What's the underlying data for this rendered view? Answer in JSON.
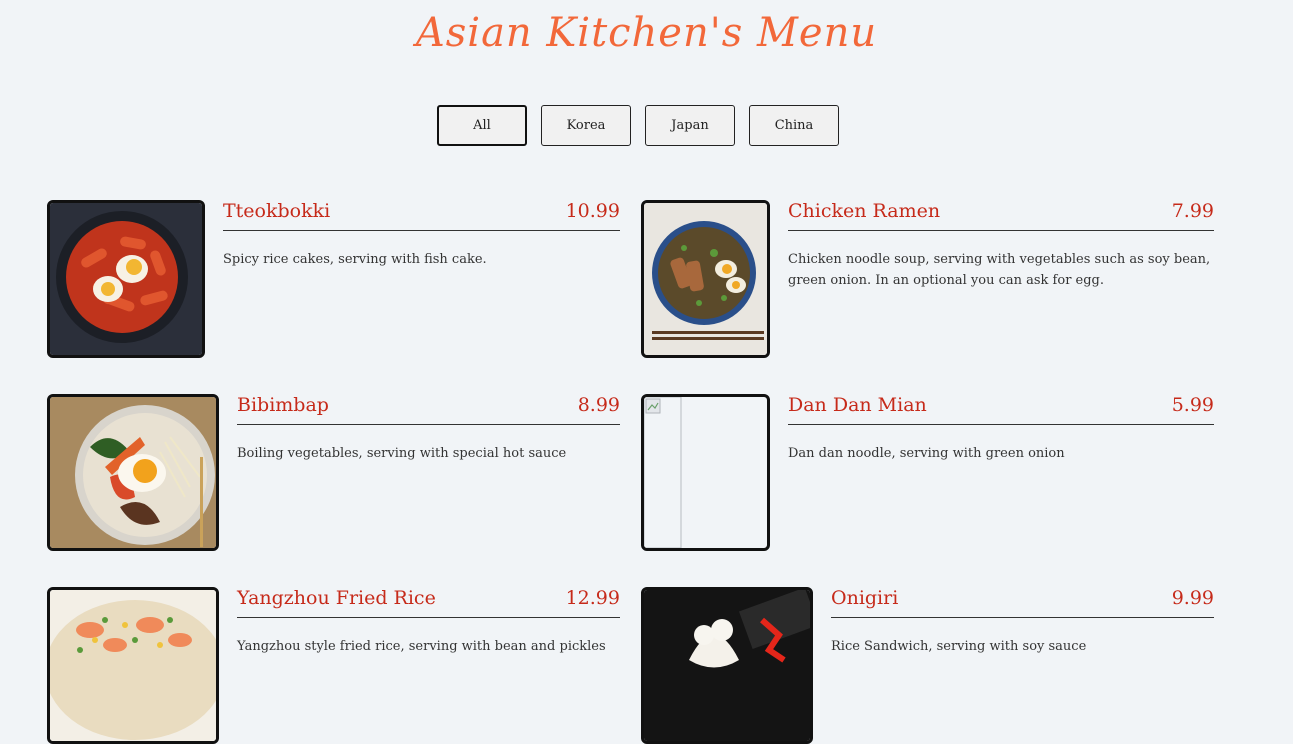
{
  "title": "Asian Kitchen's Menu",
  "filters": [
    {
      "label": "All",
      "active": true
    },
    {
      "label": "Korea",
      "active": false
    },
    {
      "label": "Japan",
      "active": false
    },
    {
      "label": "China",
      "active": false
    }
  ],
  "items": [
    {
      "name": "Tteokbokki",
      "price": "10.99",
      "desc": "Spicy rice cakes, serving with fish cake."
    },
    {
      "name": "Chicken Ramen",
      "price": "7.99",
      "desc": "Chicken noodle soup, serving with vegetables such as soy bean, green onion. In an optional you can ask for egg."
    },
    {
      "name": "Bibimbap",
      "price": "8.99",
      "desc": "Boiling vegetables, serving with special hot sauce"
    },
    {
      "name": "Dan Dan Mian",
      "price": "5.99",
      "desc": "Dan dan noodle, serving with green onion"
    },
    {
      "name": "Yangzhou Fried Rice",
      "price": "12.99",
      "desc": "Yangzhou style fried rice, serving with bean and pickles"
    },
    {
      "name": "Onigiri",
      "price": "9.99",
      "desc": "Rice Sandwich, serving with soy sauce"
    }
  ],
  "colors": {
    "accent": "#f2683a",
    "item_text": "#c62a1a",
    "background": "#f1f4f7"
  }
}
